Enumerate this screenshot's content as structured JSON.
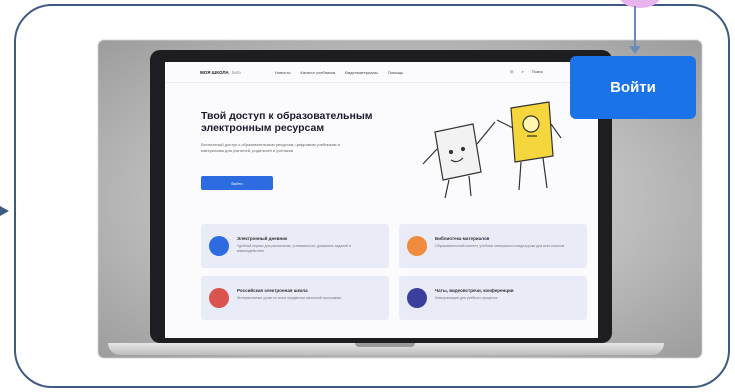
{
  "overlay": {
    "login_label": "Войти"
  },
  "site": {
    "logo": "МОЯ ШКОЛА",
    "logo_suffix": "beta",
    "nav_links": [
      "Новости",
      "Каталог учебников",
      "Видеоматериалы",
      "Помощь"
    ],
    "nav_right": [
      "Поиск"
    ],
    "hero_title": "Твой доступ к образовательным электронным ресурсам",
    "hero_text": "Бесплатный доступ к образовательным ресурсам, цифровым учебникам и материалам для учителей, родителей и учеников",
    "hero_button": "Войти",
    "cards": [
      {
        "title": "Электронный дневник",
        "text": "Удобный сервис для расписания, успеваемости, домашних заданий и взаимодействия"
      },
      {
        "title": "Библиотека материалов",
        "text": "Образовательный контент, учебные материалы и видеоуроки для всех классов"
      },
      {
        "title": "Российская электронная школа",
        "text": "Интерактивные уроки по всем предметам школьной программы"
      },
      {
        "title": "Чаты, видеовстречи, конференции",
        "text": "Коммуникация для учебного процесса"
      }
    ]
  },
  "colors": {
    "accent": "#1a73e8",
    "frame": "#3d5a80",
    "card_bg": "#e9ebf7",
    "icon_blue": "#2d6be0",
    "icon_orange": "#f08a3c",
    "icon_red": "#d9534f",
    "icon_indigo": "#3b3f9c"
  }
}
